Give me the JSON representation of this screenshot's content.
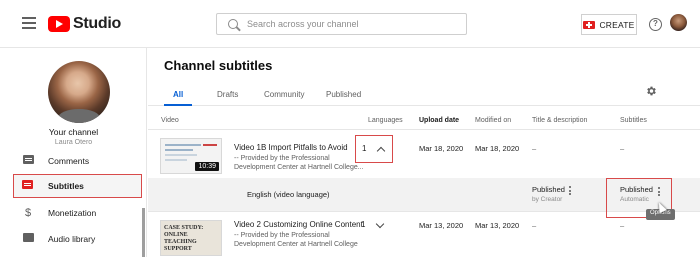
{
  "header": {
    "logo_text": "Studio",
    "search_placeholder": "Search across your channel",
    "create_label": "CREATE",
    "help_glyph": "?"
  },
  "sidebar": {
    "your_channel": "Your channel",
    "channel_name": "Laura Otero",
    "items": [
      {
        "label": "Comments",
        "icon": "comments-icon"
      },
      {
        "label": "Subtitles",
        "icon": "subtitles-icon",
        "active": true
      },
      {
        "label": "Monetization",
        "icon": "dollar-icon",
        "glyph": "$"
      },
      {
        "label": "Audio library",
        "icon": "audio-library-icon"
      }
    ]
  },
  "main": {
    "title": "Channel subtitles",
    "tabs": [
      {
        "label": "All",
        "active": true
      },
      {
        "label": "Drafts"
      },
      {
        "label": "Community"
      },
      {
        "label": "Published"
      }
    ],
    "columns": {
      "video": "Video",
      "languages": "Languages",
      "upload_date": "Upload date",
      "modified_on": "Modified on",
      "title_description": "Title & description",
      "subtitles": "Subtitles"
    },
    "videos": [
      {
        "title": "Video 1B Import Pitfalls to Avoid",
        "desc_line1": "-- Provided by the Professional",
        "desc_line2": "Development Center at Hartnell College...",
        "duration": "10:39",
        "languages": "1",
        "upload_date": "Mar 18, 2020",
        "modified_on": "Mar 18, 2020",
        "title_description": "–",
        "subtitles": "–"
      },
      {
        "title": "Video 2 Customizing Online Content",
        "desc_line1": "-- Provided by the Professional",
        "desc_line2": "Development Center at Hartnell College",
        "thumb_text": "CASE STUDY: ONLINE TEACHING SUPPORT",
        "languages": "1",
        "upload_date": "Mar 13, 2020",
        "modified_on": "Mar 13, 2020",
        "title_description": "–",
        "subtitles": "–"
      }
    ],
    "language_row": {
      "language": "English (video language)",
      "title_status": "Published",
      "title_by": "by Creator",
      "subs_status": "Published",
      "subs_by": "Automatic"
    },
    "tooltip": "Options"
  }
}
